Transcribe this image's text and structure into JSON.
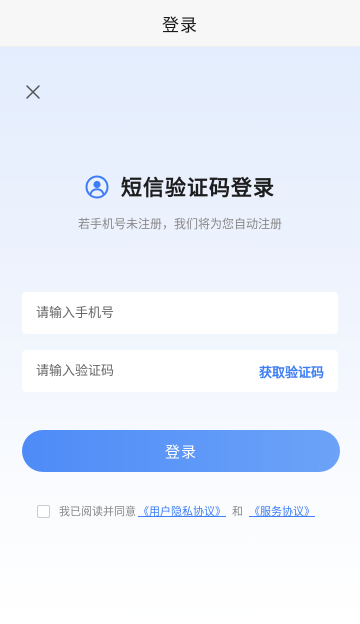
{
  "nav": {
    "title": "登录"
  },
  "form": {
    "heading": "短信验证码登录",
    "subtitle": "若手机号未注册，我们将为您自动注册",
    "phone_placeholder": "请输入手机号",
    "code_placeholder": "请输入验证码",
    "get_code_label": "获取验证码",
    "login_button_label": "登录"
  },
  "agreement": {
    "prefix": "我已阅读并同意",
    "privacy_link": "《用户隐私协议》",
    "and": "和",
    "service_link": "《服务协议》",
    "checked": false
  },
  "icons": {
    "close": "close-icon",
    "user": "user-circle-icon"
  },
  "colors": {
    "accent": "#3d7df5",
    "button_start": "#4e8bf7",
    "button_end": "#6ca3f8"
  }
}
